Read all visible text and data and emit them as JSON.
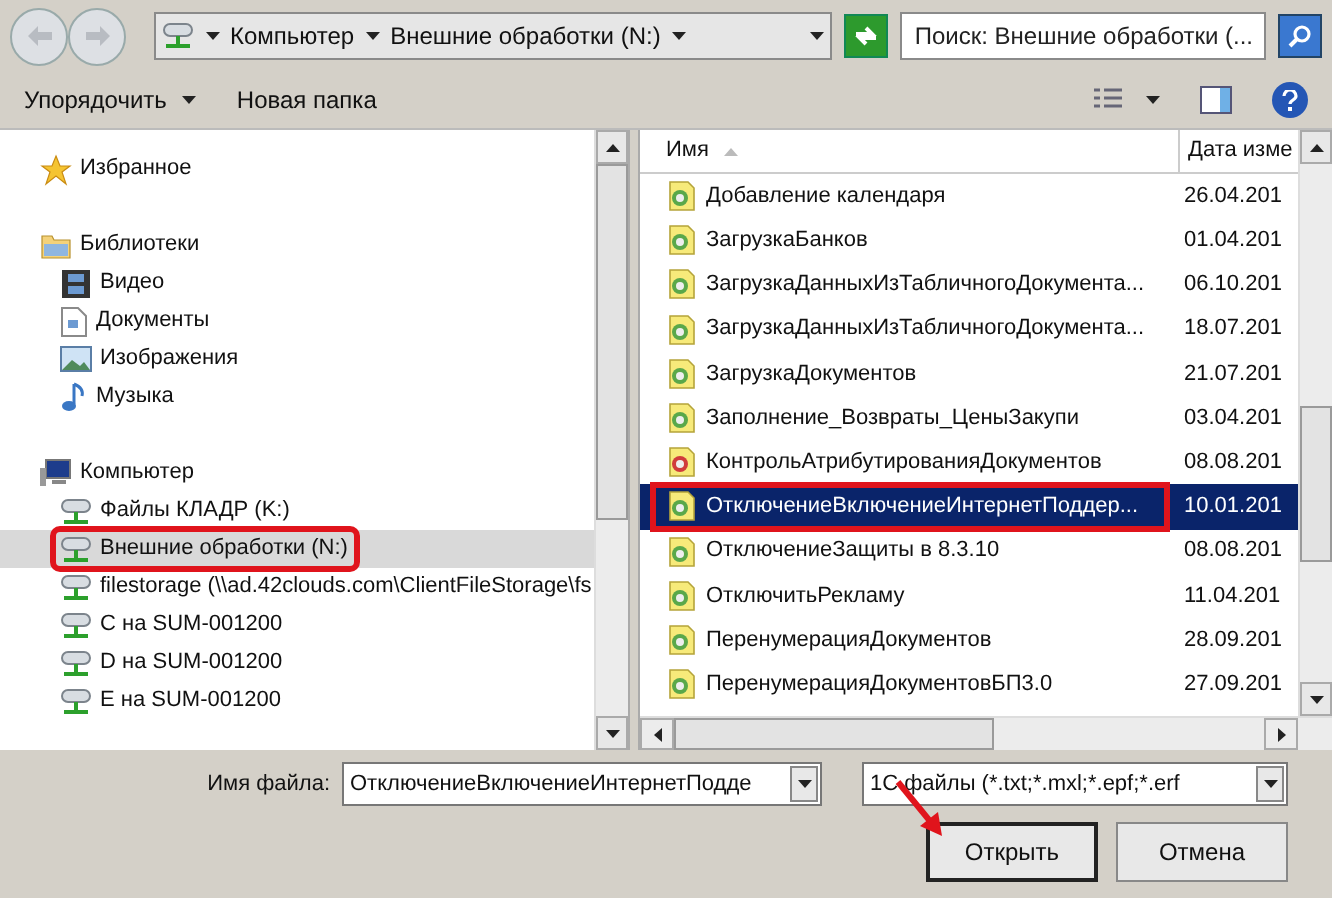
{
  "address": {
    "crumbs": [
      "Компьютер",
      "Внешние обработки (N:)"
    ]
  },
  "search": {
    "placeholder": "Поиск: Внешние обработки (..."
  },
  "toolbar": {
    "organize": "Упорядочить",
    "new_folder": "Новая папка"
  },
  "nav": [
    {
      "label": "Избранное",
      "kind": "star",
      "selected": false,
      "annotated": false
    },
    {
      "label": "Библиотеки",
      "kind": "library",
      "selected": false,
      "annotated": false,
      "children": [
        {
          "label": "Видео",
          "kind": "video",
          "selected": false,
          "annotated": false
        },
        {
          "label": "Документы",
          "kind": "doc",
          "selected": false,
          "annotated": false
        },
        {
          "label": "Изображения",
          "kind": "image",
          "selected": false,
          "annotated": false
        },
        {
          "label": "Музыка",
          "kind": "music",
          "selected": false,
          "annotated": false
        }
      ]
    },
    {
      "label": "Компьютер",
      "kind": "computer",
      "selected": false,
      "annotated": false,
      "children": [
        {
          "label": "Файлы КЛАДР (K:)",
          "kind": "drive",
          "selected": false,
          "annotated": false
        },
        {
          "label": "Внешние обработки (N:)",
          "kind": "drive",
          "selected": true,
          "annotated": true
        },
        {
          "label": "filestorage (\\\\ad.42clouds.com\\ClientFileStorage\\fs",
          "kind": "drive",
          "selected": false,
          "annotated": false
        },
        {
          "label": "C на SUM-001200",
          "kind": "drive",
          "selected": false,
          "annotated": false
        },
        {
          "label": "D на SUM-001200",
          "kind": "drive",
          "selected": false,
          "annotated": false
        },
        {
          "label": "E на SUM-001200",
          "kind": "drive",
          "selected": false,
          "annotated": false
        }
      ]
    }
  ],
  "table": {
    "columns": [
      "Имя",
      "Дата изме"
    ],
    "rows": [
      {
        "name": "Добавление календаря",
        "date": "26.04.201",
        "selected": false,
        "annotated": false,
        "kind": "epf"
      },
      {
        "name": "ЗагрузкаБанков",
        "date": "01.04.201",
        "selected": false,
        "annotated": false,
        "kind": "epf"
      },
      {
        "name": "ЗагрузкаДанныхИзТабличногоДокумента...",
        "date": "06.10.201",
        "selected": false,
        "annotated": false,
        "kind": "epf"
      },
      {
        "name": "ЗагрузкаДанныхИзТабличногоДокумента...",
        "date": "18.07.201",
        "selected": false,
        "annotated": false,
        "kind": "epf"
      },
      {
        "name": "ЗагрузкаДокументов",
        "date": "21.07.201",
        "selected": false,
        "annotated": false,
        "kind": "epf"
      },
      {
        "name": "Заполнение_Возвраты_ЦеныЗакупи",
        "date": "03.04.201",
        "selected": false,
        "annotated": false,
        "kind": "epf"
      },
      {
        "name": "КонтрольАтрибутированияДокументов",
        "date": "08.08.201",
        "selected": false,
        "annotated": false,
        "kind": "erf"
      },
      {
        "name": "ОтключениеВключениеИнтернетПоддер...",
        "date": "10.01.201",
        "selected": true,
        "annotated": true,
        "kind": "epf"
      },
      {
        "name": "ОтключениеЗащиты в 8.3.10",
        "date": "08.08.201",
        "selected": false,
        "annotated": false,
        "kind": "epf"
      },
      {
        "name": "ОтключитьРекламу",
        "date": "11.04.201",
        "selected": false,
        "annotated": false,
        "kind": "epf"
      },
      {
        "name": "ПеренумерацияДокументов",
        "date": "28.09.201",
        "selected": false,
        "annotated": false,
        "kind": "epf"
      },
      {
        "name": "ПеренумерацияДокументовБП3.0",
        "date": "27.09.201",
        "selected": false,
        "annotated": false,
        "kind": "epf"
      }
    ]
  },
  "filename": {
    "label": "Имя файла:",
    "value": "ОтключениеВключениеИнтернетПодде"
  },
  "filter": {
    "value": "1C файлы (*.txt;*.mxl;*.epf;*.erf"
  },
  "buttons": [
    {
      "label": "Открыть",
      "annotated": true
    },
    {
      "label": "Отмена",
      "annotated": false
    }
  ]
}
